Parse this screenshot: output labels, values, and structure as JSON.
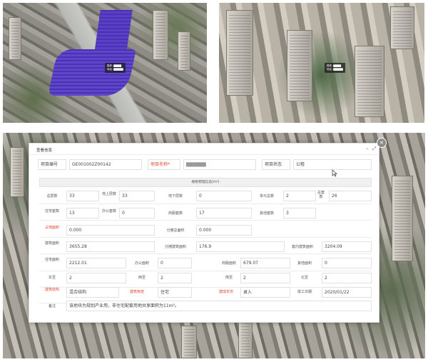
{
  "scenes": {
    "top_left_tooltip": [
      "楼栋: ▇▇▇▇",
      "地址: ▇▇▇▇▇"
    ],
    "top_right_tooltip": [
      "楼栋: ▇▇▇▇",
      "地址: ▇▇▇▇▇"
    ]
  },
  "dialog": {
    "title": "查看信息",
    "min_icon": "minimize-icon",
    "max_icon": "maximize-icon",
    "close_icon": "close-icon",
    "header_row": {
      "code_label": "项目编号",
      "code_value": "GE001002Z00142",
      "name_label": "项目名称*",
      "name_value": "▇▇▇▇▇▇",
      "status_label": "项目状态",
      "status_value": "公租"
    },
    "section_title": "楼栋物理信息(m²)",
    "rows": [
      [
        {
          "label": "总层数",
          "value": "33"
        },
        {
          "label": "地上层数",
          "value": "33"
        },
        {
          "label": "地下层数",
          "value": "0"
        },
        {
          "label": "单元总数",
          "value": "2"
        },
        {
          "label": "总套数",
          "value": "26"
        }
      ],
      [
        {
          "label": "住宅套数",
          "value": "13"
        },
        {
          "label": "办公套数",
          "value": "0"
        },
        {
          "label": "商服套数",
          "value": "17"
        },
        {
          "label": "其他套数",
          "value": "3"
        }
      ],
      [
        {
          "label": "占地面积",
          "value": "0.000"
        },
        {
          "label": "分摊总面积",
          "value": "0.000"
        }
      ],
      [
        {
          "label": "建筑面积",
          "value": "3655.28"
        },
        {
          "label": "分摊建筑面积",
          "value": "176.9"
        },
        {
          "label": "套内建筑面积",
          "value": "3204.09"
        }
      ],
      [
        {
          "label": "住宅面积",
          "value": "2212.01"
        },
        {
          "label": "办公面积",
          "value": "0"
        },
        {
          "label": "商服面积",
          "value": "679.07"
        },
        {
          "label": "其他面积",
          "value": "0"
        }
      ],
      [
        {
          "label": "东至",
          "value": "2"
        },
        {
          "label": "西至",
          "value": "2"
        },
        {
          "label": "南至",
          "value": "2"
        },
        {
          "label": "北至",
          "value": "2"
        }
      ],
      [
        {
          "label": "建筑结构",
          "value": "混合结构"
        },
        {
          "label": "建筑用途",
          "value": "住宅"
        },
        {
          "label": "建成年份",
          "value": "录入"
        },
        {
          "label": "竣工日期",
          "value": "2020/01/22"
        }
      ],
      [
        {
          "label": "备注",
          "value": "该地块为规划产业用，非住宅配套用地共享面积为11m²。"
        }
      ]
    ]
  }
}
